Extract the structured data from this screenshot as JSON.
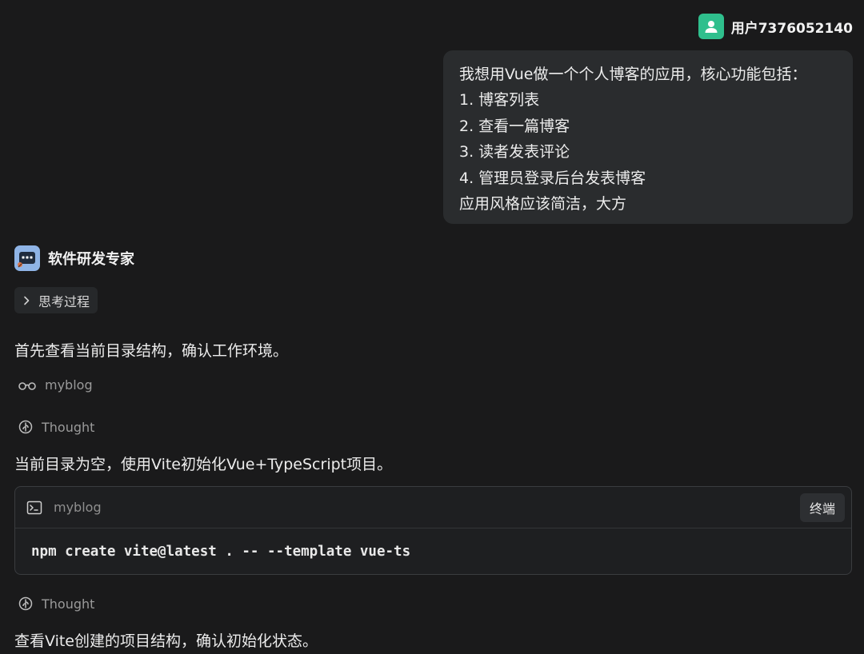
{
  "user": {
    "name": "用户7376052140",
    "message_lines": [
      "我想用Vue做一个个人博客的应用，核心功能包括：",
      "1. 博客列表",
      "2. 查看一篇博客",
      "3. 读者发表评论",
      "4. 管理员登录后台发表博客",
      "应用风格应该简洁，大方"
    ]
  },
  "assistant": {
    "name": "软件研发专家",
    "thinking_label": "思考过程",
    "step1_text": "首先查看当前目录结构，确认工作环境。",
    "view_dir": "myblog",
    "thought1_label": "Thought",
    "step2_text": "当前目录为空，使用Vite初始化Vue+TypeScript项目。",
    "terminal": {
      "cwd": "myblog",
      "button_label": "终端",
      "command": "npm create vite@latest . -- --template vue-ts"
    },
    "thought2_label": "Thought",
    "step3_text": "查看Vite创建的项目结构，确认初始化状态。"
  },
  "colors": {
    "background": "#1a1a1b",
    "user_avatar": "#2fbf8d",
    "bot_avatar": "#8fb4e6",
    "bubble": "#2a2c2e"
  },
  "icons": {
    "user_avatar": "person-icon",
    "bot_avatar": "robot-icon",
    "thinking": "chevron-right-icon",
    "view": "glasses-icon",
    "thought": "thought-icon",
    "terminal": "terminal-icon"
  }
}
